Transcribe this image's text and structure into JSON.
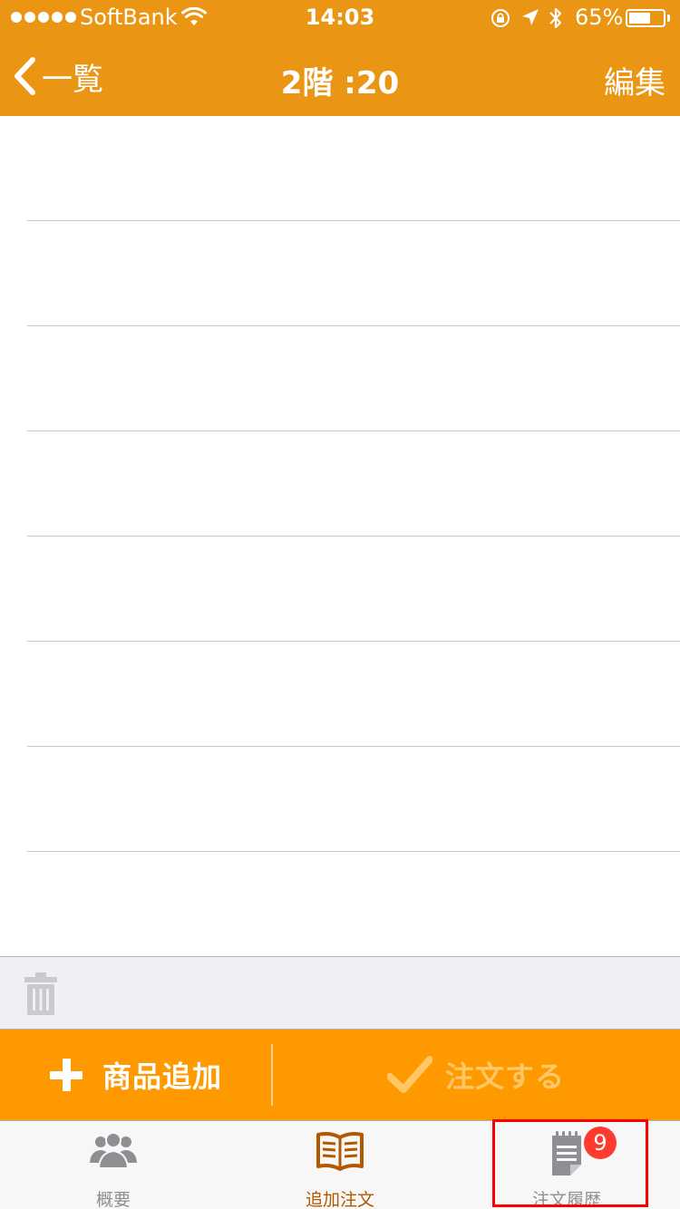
{
  "status_bar": {
    "carrier": "SoftBank",
    "time": "14:03",
    "battery": "65%",
    "battery_level": 0.65
  },
  "nav_bar": {
    "back_label": "一覧",
    "title": "2階 :20",
    "edit_label": "編集"
  },
  "order_list": {
    "rows": [
      "",
      "",
      "",
      "",
      "",
      "",
      "",
      ""
    ]
  },
  "toolbar": {
    "trash_icon": "trash-icon"
  },
  "action_bar": {
    "add_label": "商品追加",
    "order_label": "注文する",
    "order_enabled": false
  },
  "tab_bar": {
    "tabs": [
      {
        "label": "概要",
        "icon": "people-icon",
        "active": false
      },
      {
        "label": "追加注文",
        "icon": "open-book-icon",
        "active": true
      },
      {
        "label": "注文履歴",
        "icon": "notepad-icon",
        "active": false,
        "badge": "9"
      }
    ]
  },
  "colors": {
    "nav_orange": "#EA9614",
    "action_orange": "#FF9900",
    "badge_red": "#FF3B30",
    "highlight_red": "#FF0000"
  }
}
